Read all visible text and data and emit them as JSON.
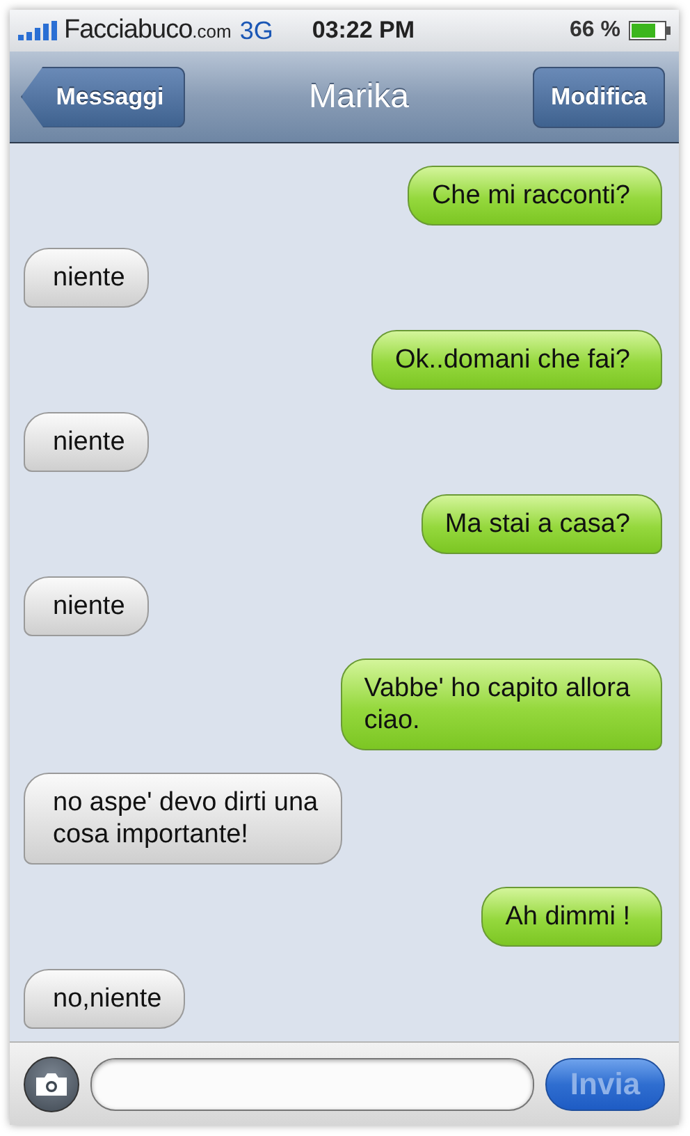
{
  "status_bar": {
    "carrier": "Facciabuco",
    "carrier_domain": ".com",
    "network": "3G",
    "time": "03:22 PM",
    "battery": "66 %"
  },
  "nav_bar": {
    "back": "Messaggi",
    "title": "Marika",
    "edit": "Modifica"
  },
  "messages": [
    {
      "kind": "sent",
      "lines": [
        "Che mi racconti?"
      ]
    },
    {
      "kind": "received",
      "lines": [
        "niente"
      ]
    },
    {
      "kind": "sent",
      "lines": [
        "Ok..domani che fai?"
      ]
    },
    {
      "kind": "received",
      "lines": [
        "niente"
      ]
    },
    {
      "kind": "sent",
      "lines": [
        "Ma stai a casa?"
      ]
    },
    {
      "kind": "received",
      "lines": [
        "niente"
      ]
    },
    {
      "kind": "sent",
      "lines": [
        "Vabbe' ho capito allora",
        "ciao."
      ]
    },
    {
      "kind": "received",
      "lines": [
        "no aspe' devo dirti una",
        "cosa importante!"
      ]
    },
    {
      "kind": "sent",
      "lines": [
        "Ah dimmi !"
      ]
    },
    {
      "kind": "received",
      "lines": [
        "no,niente"
      ]
    }
  ],
  "compose_bar": {
    "send": "Invia",
    "send_disabled": true
  }
}
